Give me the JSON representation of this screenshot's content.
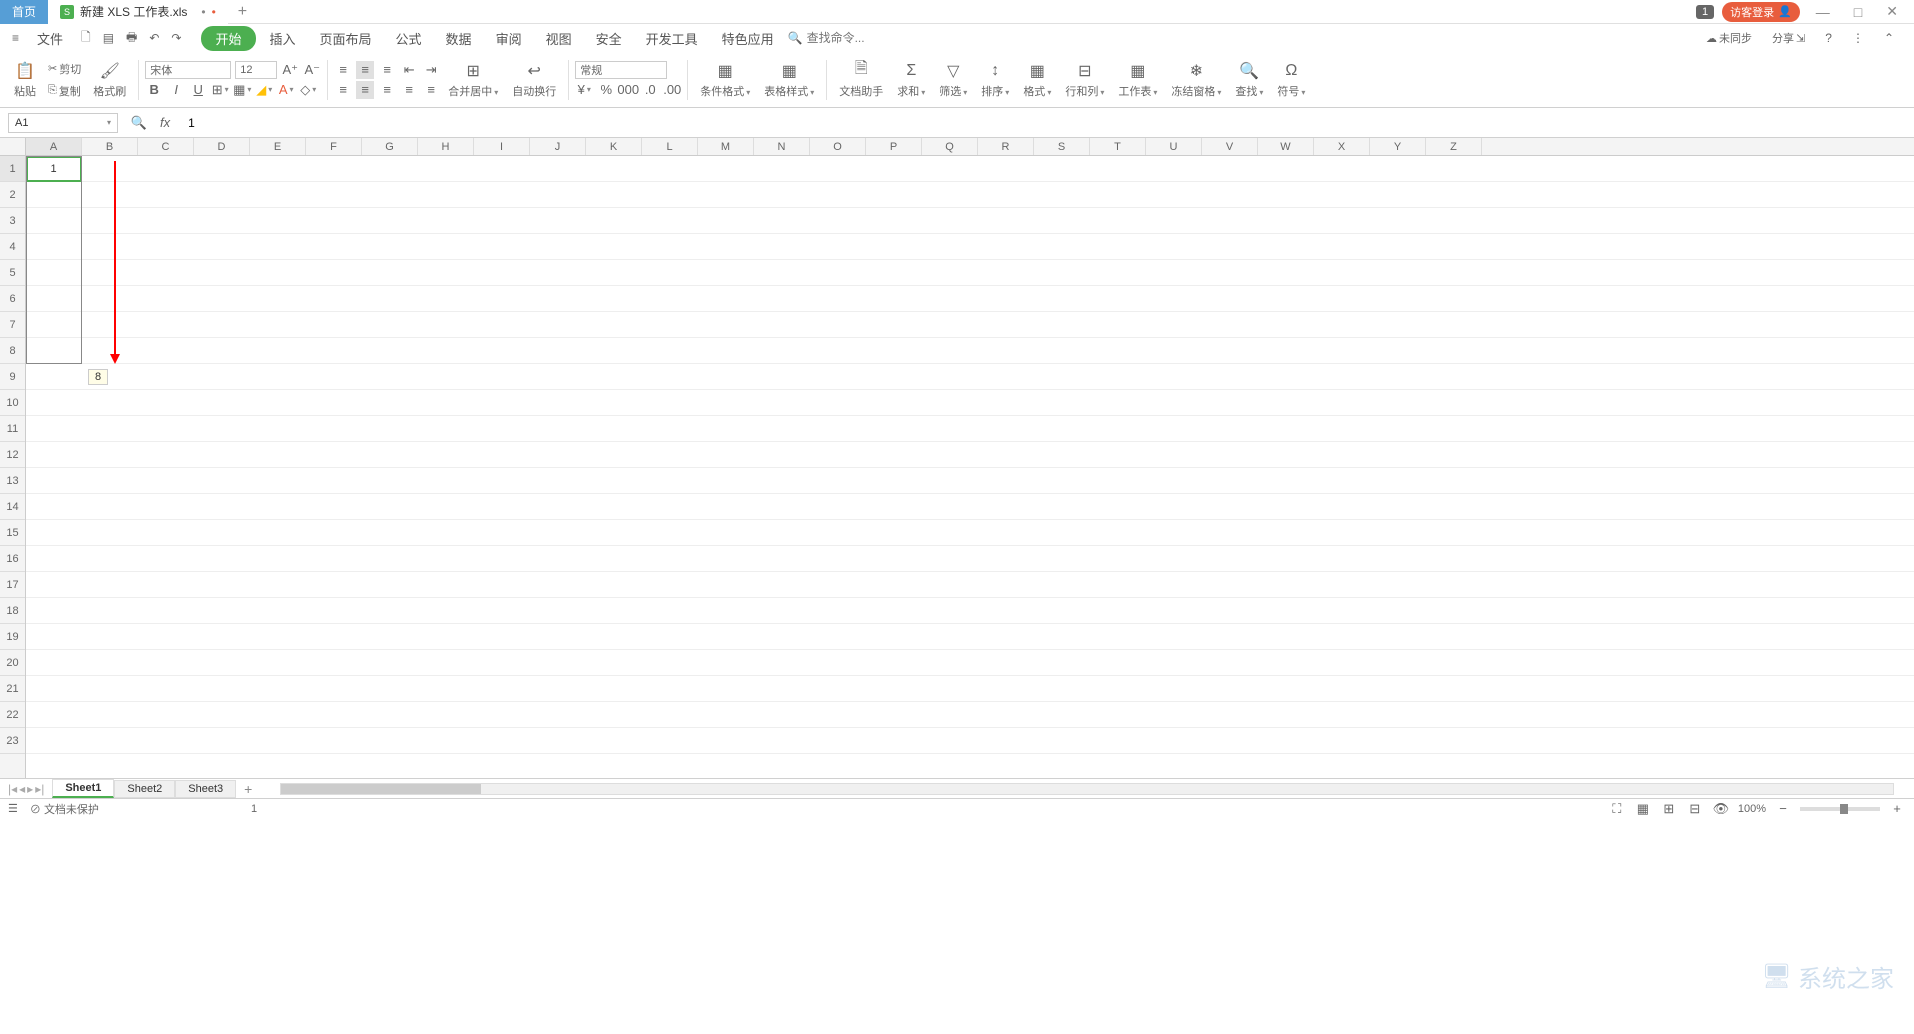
{
  "titlebar": {
    "home_tab": "首页",
    "doc_tab": "新建 XLS 工作表.xls",
    "doc_icon": "S",
    "badge": "1",
    "login": "访客登录"
  },
  "menubar": {
    "file": "文件",
    "items": [
      "开始",
      "插入",
      "页面布局",
      "公式",
      "数据",
      "审阅",
      "视图",
      "安全",
      "开发工具",
      "特色应用"
    ],
    "search_placeholder": "查找命令...",
    "sync": "未同步",
    "share": "分享"
  },
  "ribbon": {
    "paste": "粘贴",
    "cut": "剪切",
    "copy": "复制",
    "format_painter": "格式刷",
    "font_name": "宋体",
    "font_size": "12",
    "merge": "合并居中",
    "wrap": "自动换行",
    "number_format": "常规",
    "cond_format": "条件格式",
    "table_style": "表格样式",
    "doc_helper": "文档助手",
    "sum": "求和",
    "filter": "筛选",
    "sort": "排序",
    "format": "格式",
    "rowcol": "行和列",
    "worksheet": "工作表",
    "freeze": "冻结窗格",
    "find": "查找",
    "symbol": "符号"
  },
  "formula": {
    "cell_ref": "A1",
    "value": "1"
  },
  "grid": {
    "columns": [
      "A",
      "B",
      "C",
      "D",
      "E",
      "F",
      "G",
      "H",
      "I",
      "J",
      "K",
      "L",
      "M",
      "N",
      "O",
      "P",
      "Q",
      "R",
      "S",
      "T",
      "U",
      "V",
      "W",
      "X",
      "Y",
      "Z"
    ],
    "rows": [
      1,
      2,
      3,
      4,
      5,
      6,
      7,
      8,
      9,
      10,
      11,
      12,
      13,
      14,
      15,
      16,
      17,
      18,
      19,
      20,
      21,
      22,
      23
    ],
    "a1_value": "1",
    "fill_tooltip": "8"
  },
  "sheets": {
    "tabs": [
      "Sheet1",
      "Sheet2",
      "Sheet3"
    ]
  },
  "statusbar": {
    "protect": "文档未保护",
    "value": "1",
    "zoom": "100%"
  },
  "watermark": "系统之家"
}
